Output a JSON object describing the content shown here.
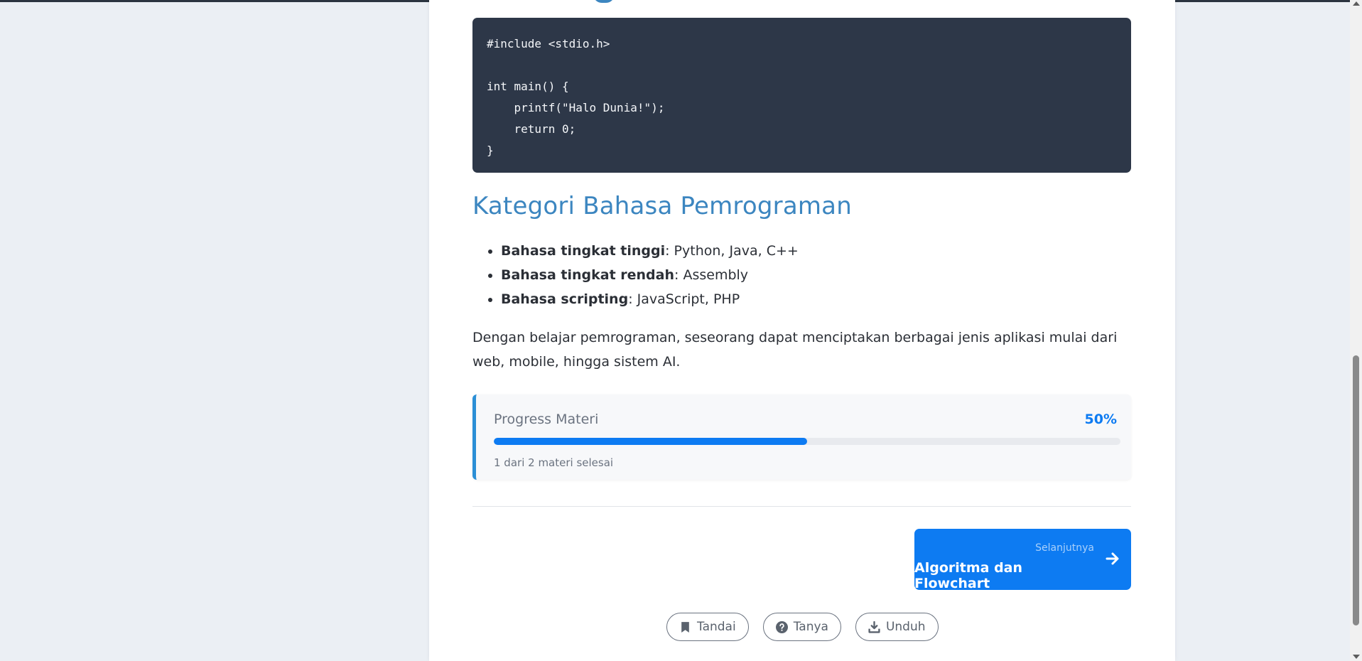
{
  "code_block": {
    "code": "#include <stdio.h>\n\nint main() {\n    printf(\"Halo Dunia!\");\n    return 0;\n}"
  },
  "section": {
    "title": "Kategori Bahasa Pemrograman",
    "items": [
      {
        "label": "Bahasa tingkat tinggi",
        "text": ": Python, Java, C++"
      },
      {
        "label": "Bahasa tingkat rendah",
        "text": ": Assembly"
      },
      {
        "label": "Bahasa scripting",
        "text": ": JavaScript, PHP"
      }
    ],
    "paragraph": "Dengan belajar pemrograman, seseorang dapat menciptakan berbagai jenis aplikasi mulai dari web, mobile, hingga sistem AI."
  },
  "progress": {
    "label": "Progress Materi",
    "percent_text": "50%",
    "value": 50,
    "caption": "1 dari 2 materi selesai"
  },
  "next": {
    "small_label": "Selanjutnya",
    "title": "Algoritma dan Flowchart"
  },
  "actions": {
    "bookmark": "Tandai",
    "ask": "Tanya",
    "download": "Unduh"
  },
  "colors": {
    "accent": "#0d7bf2",
    "heading": "#3c86c0",
    "code_bg": "#2d3748"
  }
}
